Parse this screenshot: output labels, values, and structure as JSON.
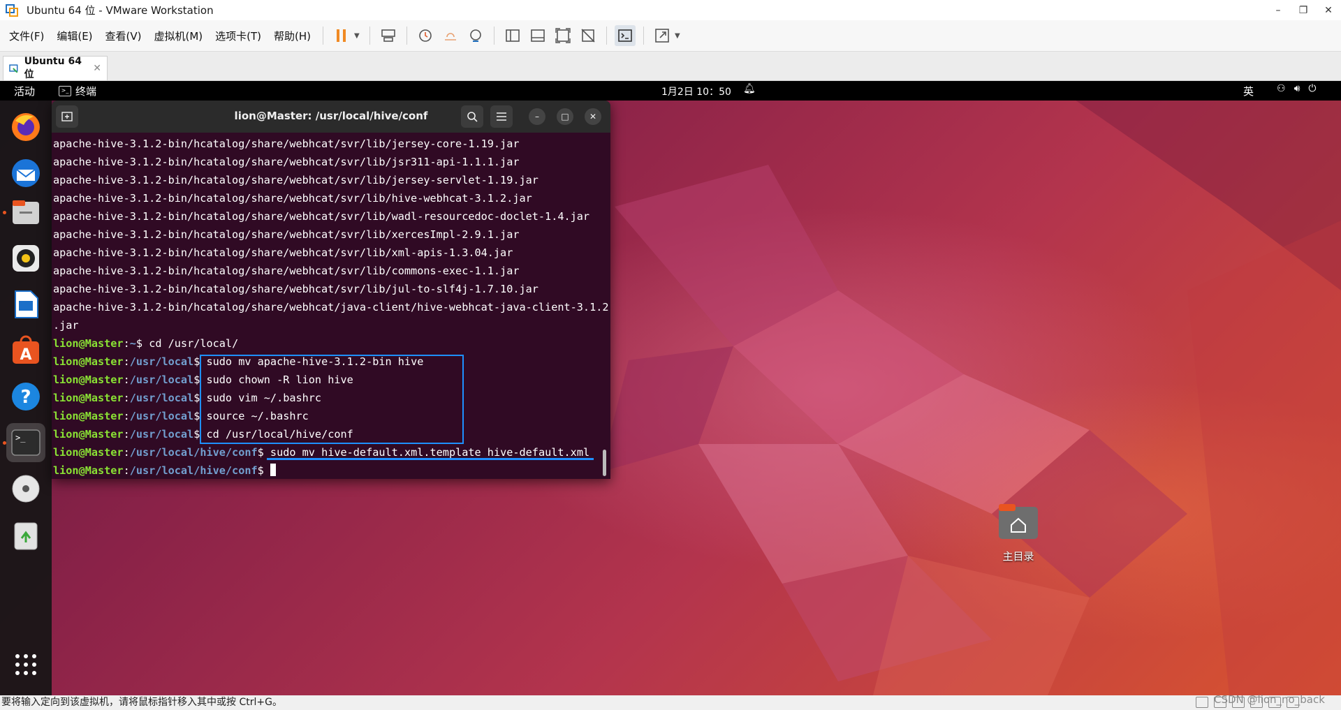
{
  "window": {
    "title": "Ubuntu 64 位 - VMware Workstation",
    "minimize": "–",
    "restore": "❐",
    "close": "✕"
  },
  "menu": {
    "items": [
      "文件(F)",
      "编辑(E)",
      "查看(V)",
      "虚拟机(M)",
      "选项卡(T)",
      "帮助(H)"
    ]
  },
  "toolbar": {
    "icons": [
      "pause-icon",
      "send-keys-icon",
      "snapshot-icon",
      "revert-snapshot-icon",
      "snapshot-manager-icon",
      "library-icon",
      "thumbnail-icon",
      "fullscreen-icon",
      "unity-icon",
      "console-icon",
      "stretch-icon"
    ]
  },
  "tab": {
    "label": "Ubuntu 64 位",
    "close": "✕"
  },
  "gnome": {
    "activities": "活动",
    "app_name": "终端",
    "clock": "1月2日 10：50",
    "ime": "英"
  },
  "terminal": {
    "title": "lion@Master: /usr/local/hive/conf",
    "output_lines": [
      "apache-hive-3.1.2-bin/hcatalog/share/webhcat/svr/lib/jersey-core-1.19.jar",
      "apache-hive-3.1.2-bin/hcatalog/share/webhcat/svr/lib/jsr311-api-1.1.1.jar",
      "apache-hive-3.1.2-bin/hcatalog/share/webhcat/svr/lib/jersey-servlet-1.19.jar",
      "apache-hive-3.1.2-bin/hcatalog/share/webhcat/svr/lib/hive-webhcat-3.1.2.jar",
      "apache-hive-3.1.2-bin/hcatalog/share/webhcat/svr/lib/wadl-resourcedoc-doclet-1.4.jar",
      "apache-hive-3.1.2-bin/hcatalog/share/webhcat/svr/lib/xercesImpl-2.9.1.jar",
      "apache-hive-3.1.2-bin/hcatalog/share/webhcat/svr/lib/xml-apis-1.3.04.jar",
      "apache-hive-3.1.2-bin/hcatalog/share/webhcat/svr/lib/commons-exec-1.1.jar",
      "apache-hive-3.1.2-bin/hcatalog/share/webhcat/svr/lib/jul-to-slf4j-1.7.10.jar",
      "apache-hive-3.1.2-bin/hcatalog/share/webhcat/java-client/hive-webhcat-java-client-3.1.2",
      ".jar"
    ],
    "commands": [
      {
        "user": "lion@Master",
        "dir": "~",
        "cmd": "cd /usr/local/"
      },
      {
        "user": "lion@Master",
        "dir": "/usr/local",
        "cmd": "sudo mv apache-hive-3.1.2-bin hive"
      },
      {
        "user": "lion@Master",
        "dir": "/usr/local",
        "cmd": "sudo chown -R lion hive"
      },
      {
        "user": "lion@Master",
        "dir": "/usr/local",
        "cmd": "sudo vim ~/.bashrc"
      },
      {
        "user": "lion@Master",
        "dir": "/usr/local",
        "cmd": "source ~/.bashrc"
      },
      {
        "user": "lion@Master",
        "dir": "/usr/local",
        "cmd": "cd /usr/local/hive/conf"
      },
      {
        "user": "lion@Master",
        "dir": "/usr/local/hive/conf",
        "cmd": "sudo mv hive-default.xml.template hive-default.xml"
      },
      {
        "user": "lion@Master",
        "dir": "/usr/local/hive/conf",
        "cmd": ""
      }
    ]
  },
  "desktop": {
    "home_folder_label": "主目录"
  },
  "dock": {
    "apps": [
      "firefox-icon",
      "thunderbird-icon",
      "files-icon",
      "rhythmbox-icon",
      "writer-icon",
      "app-center-icon",
      "help-icon",
      "terminal-icon",
      "dvd-icon",
      "trash-icon",
      "show-apps-icon"
    ]
  },
  "status": {
    "hint": "要将输入定向到该虚拟机，请将鼠标指针移入其中或按 Ctrl+G。",
    "watermark": "CSDN @lion_no_back"
  },
  "colors": {
    "terminal_bg": "#300a24",
    "prompt_user": "#8ae234",
    "prompt_dir": "#729fcf",
    "annotation": "#1e90ff",
    "ubuntu_orange": "#e95420"
  }
}
